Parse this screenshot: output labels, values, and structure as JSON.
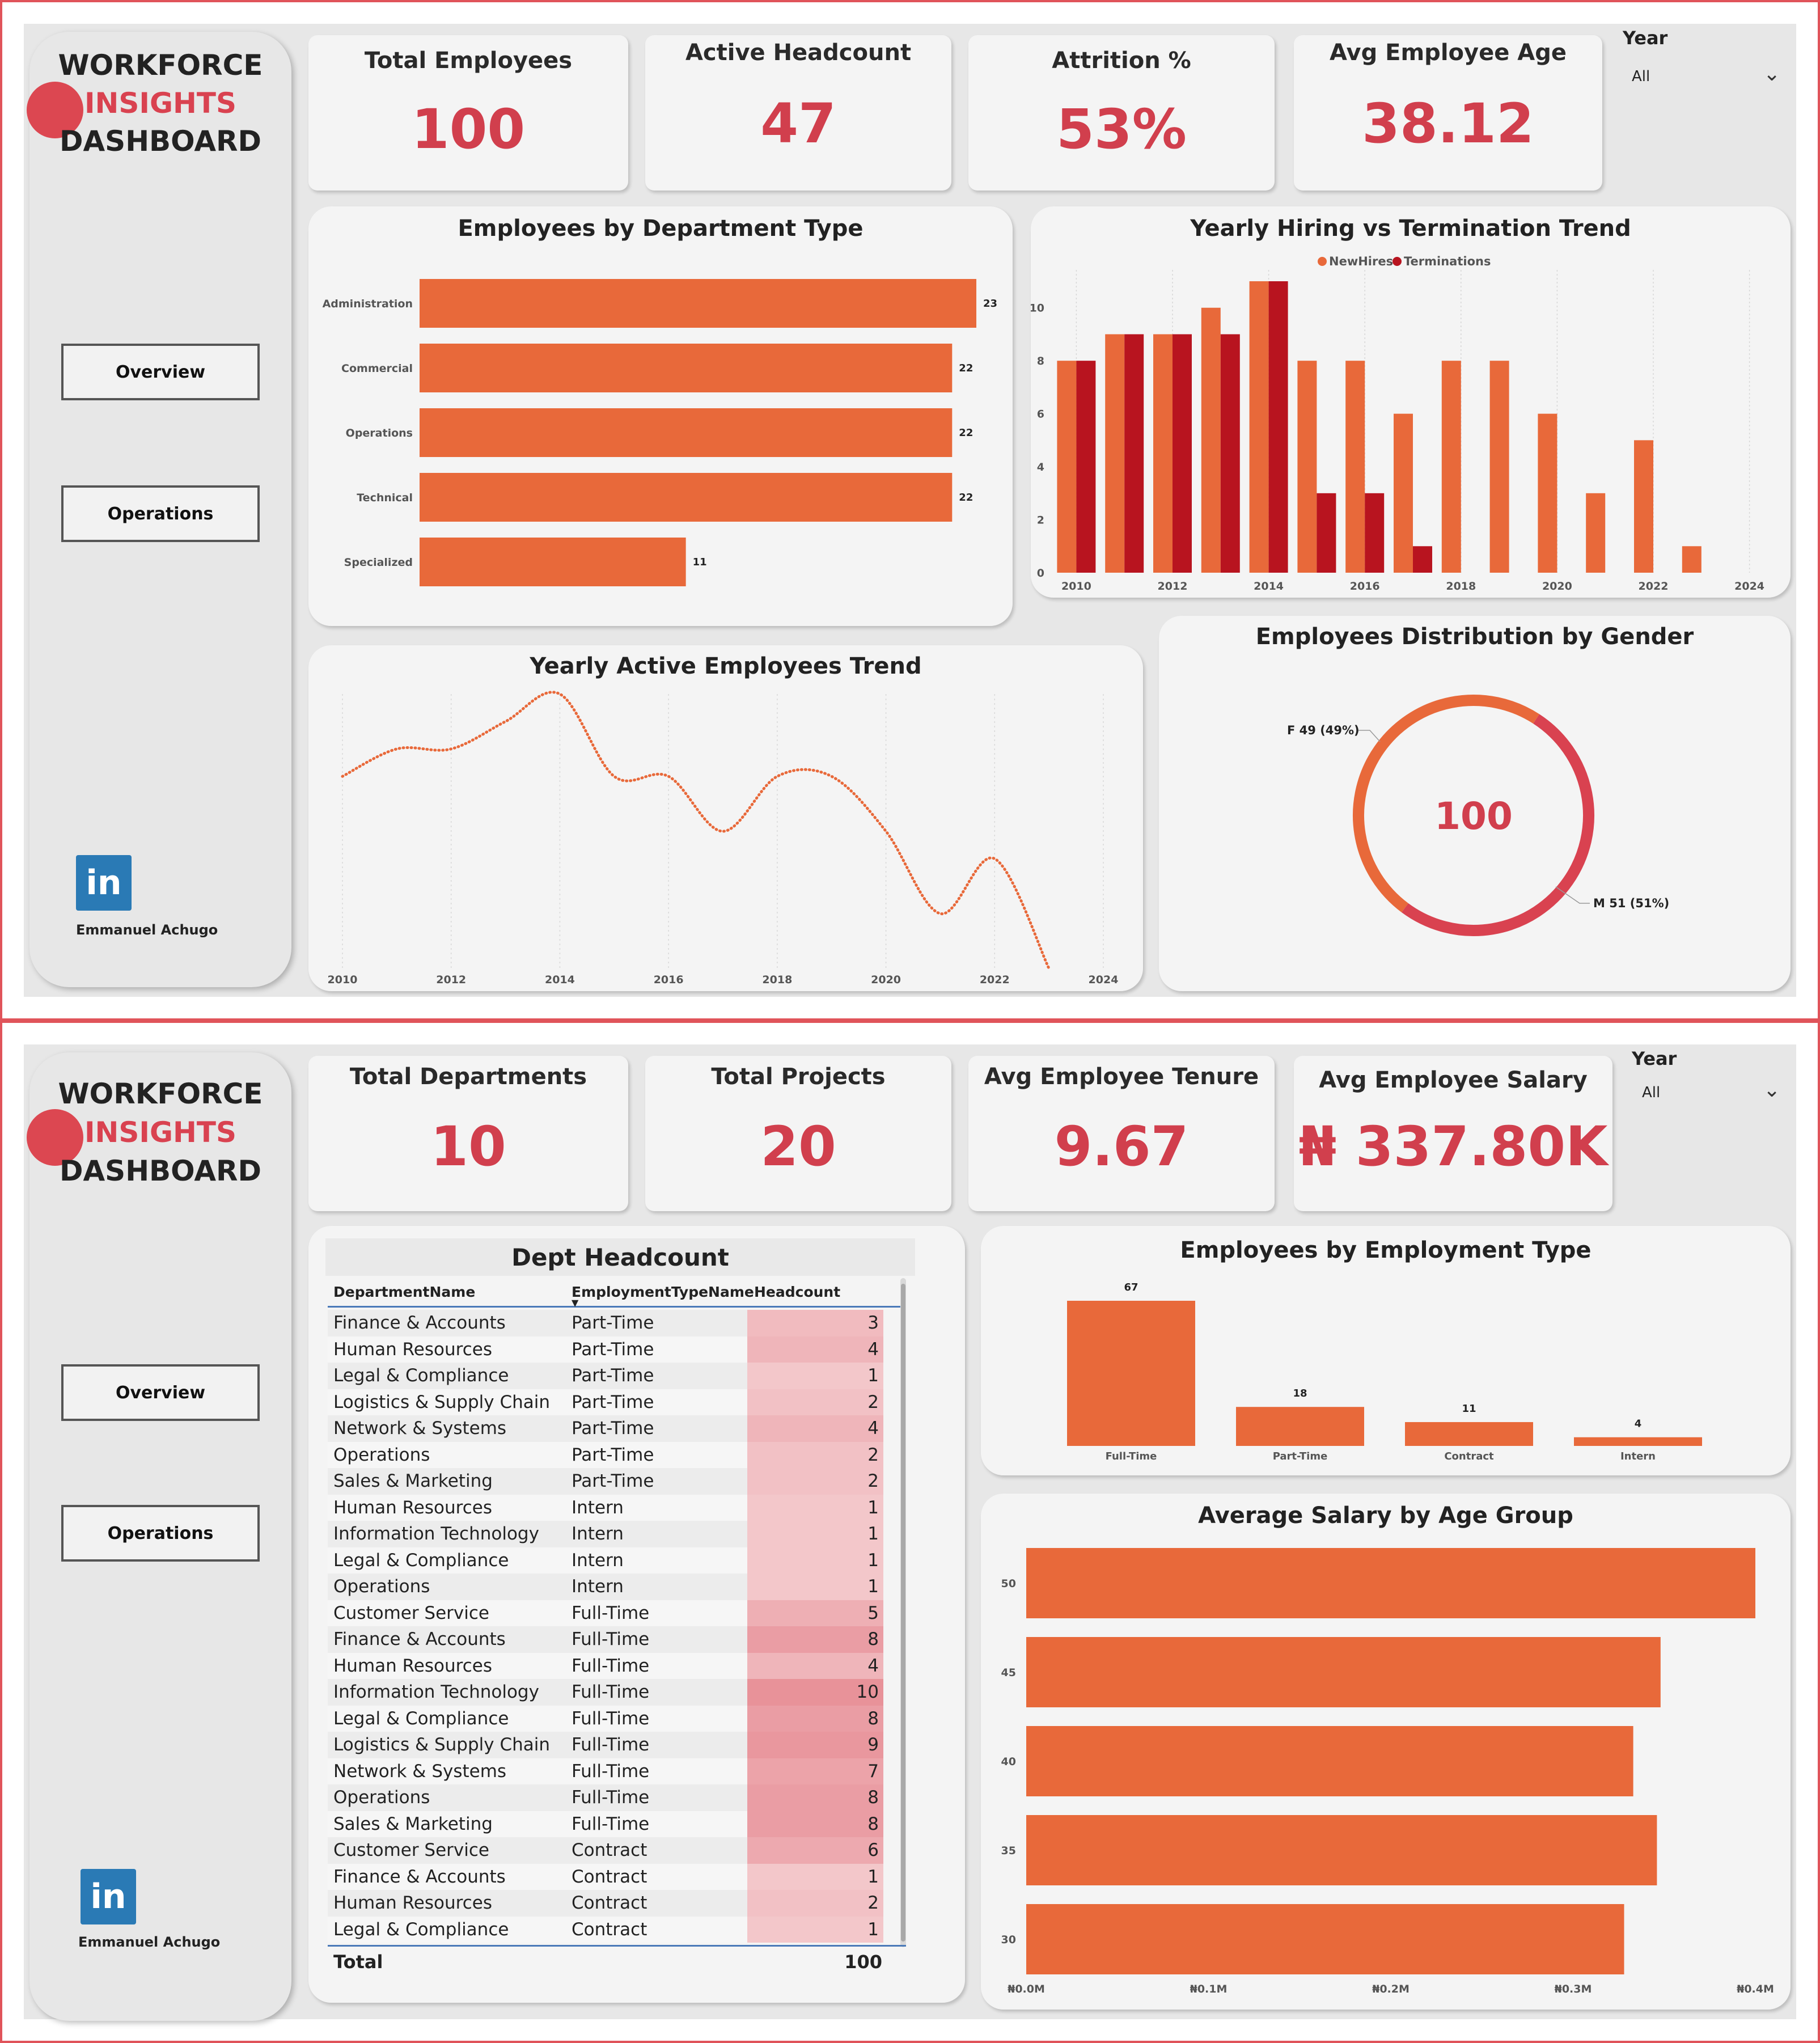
{
  "sidebar": {
    "title_line1": "WORKFORCE",
    "title_line2": "INSIGHTS",
    "title_line3": "DASHBOARD",
    "nav": [
      "Overview",
      "Operations"
    ],
    "linkedin_icon": "in",
    "author": "Emmanuel Achugo"
  },
  "filter": {
    "label": "Year",
    "value": "All"
  },
  "overview": {
    "kpis": [
      {
        "label": "Total Employees",
        "value": "100"
      },
      {
        "label": "Active Headcount",
        "value": "47"
      },
      {
        "label": "Attrition %",
        "value": "53%"
      },
      {
        "label": "Avg Employee Age",
        "value": "38.12"
      }
    ]
  },
  "operations": {
    "kpis": [
      {
        "label": "Total Departments",
        "value": "10"
      },
      {
        "label": "Total Projects",
        "value": "20"
      },
      {
        "label": "Avg Employee Tenure",
        "value": "9.67"
      },
      {
        "label": "Avg Employee Salary",
        "value": "₦ 337.80K"
      }
    ],
    "dept_table": {
      "title": "Dept Headcount",
      "columns": [
        "DepartmentName",
        "EmploymentTypeName",
        "Headcount"
      ],
      "rows": [
        [
          "Finance & Accounts",
          "Part-Time",
          "3"
        ],
        [
          "Human Resources",
          "Part-Time",
          "4"
        ],
        [
          "Legal & Compliance",
          "Part-Time",
          "1"
        ],
        [
          "Logistics & Supply Chain",
          "Part-Time",
          "2"
        ],
        [
          "Network & Systems",
          "Part-Time",
          "4"
        ],
        [
          "Operations",
          "Part-Time",
          "2"
        ],
        [
          "Sales & Marketing",
          "Part-Time",
          "2"
        ],
        [
          "Human Resources",
          "Intern",
          "1"
        ],
        [
          "Information Technology",
          "Intern",
          "1"
        ],
        [
          "Legal & Compliance",
          "Intern",
          "1"
        ],
        [
          "Operations",
          "Intern",
          "1"
        ],
        [
          "Customer Service",
          "Full-Time",
          "5"
        ],
        [
          "Finance & Accounts",
          "Full-Time",
          "8"
        ],
        [
          "Human Resources",
          "Full-Time",
          "4"
        ],
        [
          "Information Technology",
          "Full-Time",
          "10"
        ],
        [
          "Legal & Compliance",
          "Full-Time",
          "8"
        ],
        [
          "Logistics & Supply Chain",
          "Full-Time",
          "9"
        ],
        [
          "Network & Systems",
          "Full-Time",
          "7"
        ],
        [
          "Operations",
          "Full-Time",
          "8"
        ],
        [
          "Sales & Marketing",
          "Full-Time",
          "8"
        ],
        [
          "Customer Service",
          "Contract",
          "6"
        ],
        [
          "Finance & Accounts",
          "Contract",
          "1"
        ],
        [
          "Human Resources",
          "Contract",
          "2"
        ],
        [
          "Legal & Compliance",
          "Contract",
          "1"
        ]
      ],
      "total_label": "Total",
      "total_value": "100"
    }
  },
  "chart_data": [
    {
      "id": "dept",
      "type": "bar",
      "orientation": "horizontal",
      "title": "Employees by Department Type",
      "categories": [
        "Administration",
        "Commercial",
        "Operations",
        "Technical",
        "Specialized"
      ],
      "values": [
        23,
        22,
        22,
        22,
        11
      ],
      "xlim": [
        0,
        23
      ],
      "color": "#e8693a"
    },
    {
      "id": "hire",
      "type": "bar",
      "title": "Yearly Hiring vs Termination Trend",
      "legend": "top",
      "x": [
        2010,
        2011,
        2012,
        2013,
        2014,
        2015,
        2016,
        2017,
        2018,
        2019,
        2020,
        2021,
        2022,
        2023
      ],
      "series": [
        {
          "name": "NewHires",
          "color": "#e8693a",
          "values": [
            8,
            9,
            9,
            10,
            11,
            8,
            8,
            6,
            8,
            8,
            6,
            3,
            5,
            1
          ]
        },
        {
          "name": "Terminations",
          "color": "#b8141f",
          "values": [
            8,
            9,
            9,
            9,
            11,
            3,
            3,
            1,
            0,
            0,
            0,
            0,
            0,
            0
          ]
        }
      ],
      "ylim": [
        0,
        11
      ],
      "yticks": [
        0,
        2,
        4,
        6,
        8,
        10
      ],
      "xticks": [
        2010,
        2012,
        2014,
        2016,
        2018,
        2020,
        2022,
        2024
      ]
    },
    {
      "id": "active",
      "type": "line",
      "title": "Yearly Active Employees Trend",
      "x": [
        2010,
        2011,
        2012,
        2013,
        2014,
        2015,
        2016,
        2017,
        2018,
        2019,
        2020,
        2021,
        2022,
        2023
      ],
      "values": [
        0,
        1,
        1,
        2,
        3,
        0,
        0,
        -2,
        0,
        0,
        -2,
        -5,
        -3,
        -7
      ],
      "ylim": [
        -7,
        3
      ],
      "xticks": [
        2010,
        2012,
        2014,
        2016,
        2018,
        2020,
        2022,
        2024
      ],
      "color": "#e8693a"
    },
    {
      "id": "gender",
      "type": "pie",
      "style": "donut",
      "title": "Employees Distribution by Gender",
      "center_label": "100",
      "slices": [
        {
          "label": "F 49 (49%)",
          "value": 49,
          "color": "#e8693a"
        },
        {
          "label": "M 51 (51%)",
          "value": 51,
          "color": "#d94250"
        }
      ]
    },
    {
      "id": "emptype",
      "type": "bar",
      "title": "Employees by Employment Type",
      "categories": [
        "Full-Time",
        "Part-Time",
        "Contract",
        "Intern"
      ],
      "values": [
        67,
        18,
        11,
        4
      ],
      "ylim": [
        0,
        67
      ],
      "color": "#e8693a"
    },
    {
      "id": "salary",
      "type": "bar",
      "orientation": "horizontal",
      "title": "Average Salary by Age Group",
      "categories": [
        "50",
        "45",
        "40",
        "35",
        "30"
      ],
      "values": [
        0.4,
        0.348,
        0.333,
        0.346,
        0.328
      ],
      "xlim": [
        0,
        0.4
      ],
      "xticks": [
        "₦0.0M",
        "₦0.1M",
        "₦0.2M",
        "₦0.3M",
        "₦0.4M"
      ],
      "color": "#e8693a"
    }
  ]
}
